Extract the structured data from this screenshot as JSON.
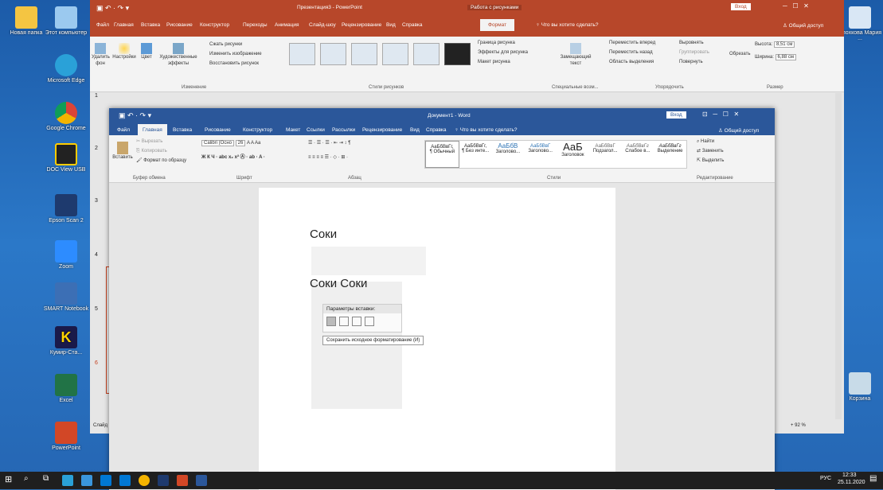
{
  "desktop": {
    "icons": [
      {
        "label": "Новая папка"
      },
      {
        "label": "Этот компьютер"
      },
      {
        "label": "Microsoft Edge"
      },
      {
        "label": "Google Chrome"
      },
      {
        "label": "DOC View USB"
      },
      {
        "label": "Epson Scan 2"
      },
      {
        "label": "Zoom"
      },
      {
        "label": "SMART Notebook"
      },
      {
        "label": "Кумир-Ста..."
      },
      {
        "label": "Excel"
      },
      {
        "label": "PowerPoint"
      },
      {
        "label": "Елохкова Мария ..."
      },
      {
        "label": "Корзина"
      }
    ]
  },
  "powerpoint": {
    "title": "Презентация3 - PowerPoint",
    "context_tab": "Работа с рисунками",
    "login": "Вход",
    "tabs": [
      "Файл",
      "Главная",
      "Вставка",
      "Рисование",
      "Конструктор",
      "Переходы",
      "Анимация",
      "Слайд-шоу",
      "Рецензирование",
      "Вид",
      "Справка",
      "Формат"
    ],
    "tell_me": "Что вы хотите сделать?",
    "share": "Общий доступ",
    "ribbon": {
      "remove_bg": "Удалить фон",
      "corrections": "Настройки",
      "color": "Цвет",
      "artistic": "Художественные эффекты",
      "compress": "Сжать рисунки",
      "change": "Изменить изображение",
      "reset": "Восстановить рисунок",
      "adjust_group": "Изменение",
      "styles_group": "Стили рисунков",
      "border": "Граница рисунка",
      "effects": "Эффекты для рисунка",
      "layout": "Макет рисунка",
      "alt_text": "Замещающий текст",
      "access_group": "Специальные возм...",
      "forward": "Переместить вперед",
      "backward": "Переместить назад",
      "selection": "Область выделения",
      "align": "Выровнять",
      "group": "Группировать",
      "rotate": "Повернуть",
      "arrange_group": "Упорядочить",
      "crop": "Обрезать",
      "height_label": "Высота:",
      "height_value": "8,51 см",
      "width_label": "Ширина:",
      "width_value": "6,88 см",
      "size_group": "Размер"
    },
    "slide_numbers": [
      "1",
      "2",
      "3",
      "4",
      "5",
      "6"
    ],
    "status": "Слайд",
    "zoom": "92 %"
  },
  "word": {
    "title": "Документ1 - Word",
    "login": "Вход",
    "tabs": [
      "Файл",
      "Главная",
      "Вставка",
      "Рисование",
      "Конструктор",
      "Макет",
      "Ссылки",
      "Рассылки",
      "Рецензирование",
      "Вид",
      "Справка"
    ],
    "tell_me": "Что вы хотите сделать?",
    "share": "Общий доступ",
    "ribbon": {
      "paste": "Вставить",
      "cut": "Вырезать",
      "copy": "Копировать",
      "format_painter": "Формат по образцу",
      "clipboard_group": "Буфер обмена",
      "font_name": "Calibri (Осно",
      "font_size": "26",
      "font_group": "Шрифт",
      "paragraph_group": "Абзац",
      "styles": [
        {
          "sample": "АаБбВвГг,",
          "name": "¶ Обычный"
        },
        {
          "sample": "АаБбВвГг,",
          "name": "¶ Без инте..."
        },
        {
          "sample": "АаБбВ",
          "name": "Заголово..."
        },
        {
          "sample": "АаБбВвГ",
          "name": "Заголово..."
        },
        {
          "sample": "АаБ",
          "name": "Заголовок"
        },
        {
          "sample": "АаБбВвГ",
          "name": "Подзагол..."
        },
        {
          "sample": "АаБбВвГг",
          "name": "Слабое в..."
        },
        {
          "sample": "АаБбВвГг",
          "name": "Выделение"
        }
      ],
      "styles_group": "Стили",
      "find": "Найти",
      "replace": "Заменить",
      "select": "Выделить",
      "edit_group": "Редактирование"
    },
    "doc": {
      "line1": "Соки",
      "line2": "Соки Соки"
    },
    "paste_popup": {
      "title": "Параметры вставки:",
      "tooltip": "Сохранить исходное форматирование (И)"
    }
  },
  "taskbar": {
    "lang": "РУС",
    "time": "12:33",
    "date": "25.11.2020"
  },
  "colors": {
    "ppt": "#b7472a",
    "word": "#2b579a",
    "taskbar": "#1f1f1f"
  }
}
